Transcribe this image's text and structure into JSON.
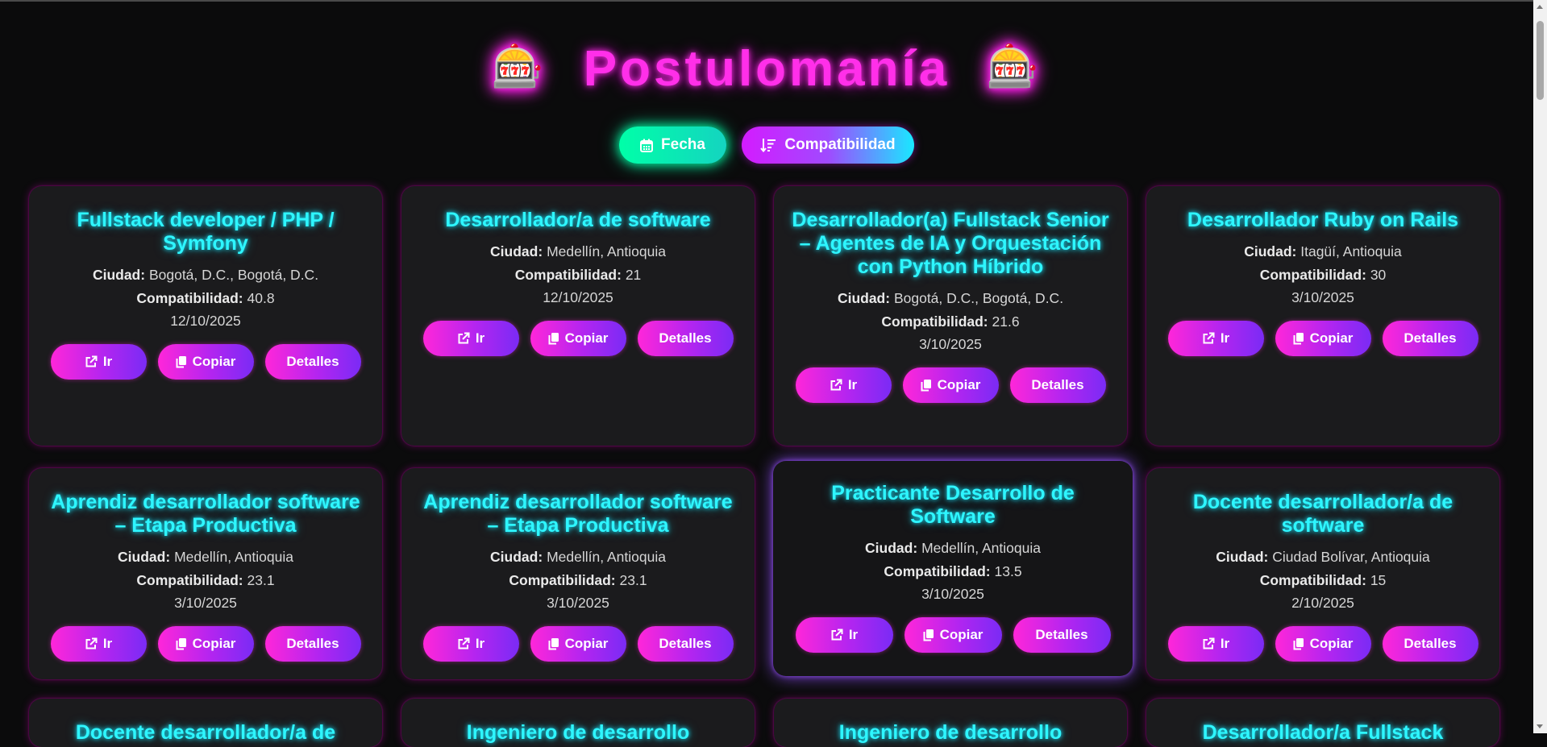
{
  "header": {
    "title": "Postulomanía",
    "emoji_left": "🎰",
    "emoji_right": "🎰"
  },
  "sort": {
    "fecha_label": "Fecha",
    "compat_label": "Compatibilidad"
  },
  "labels": {
    "ciudad": "Ciudad:",
    "compat": "Compatibilidad:",
    "ir": "Ir",
    "copiar": "Copiar",
    "detalles": "Detalles"
  },
  "jobs": [
    {
      "title": "Fullstack developer / PHP / Symfony",
      "city": "Bogotá, D.C., Bogotá, D.C.",
      "compat": "40.8",
      "date": "12/10/2025"
    },
    {
      "title": "Desarrollador/a de software",
      "city": "Medellín, Antioquia",
      "compat": "21",
      "date": "12/10/2025"
    },
    {
      "title": "Desarrollador(a) Fullstack Senior – Agentes de IA y Orquestación con Python Híbrido",
      "city": "Bogotá, D.C., Bogotá, D.C.",
      "compat": "21.6",
      "date": "3/10/2025"
    },
    {
      "title": "Desarrollador Ruby on Rails",
      "city": "Itagüí, Antioquia",
      "compat": "30",
      "date": "3/10/2025"
    },
    {
      "title": "Aprendiz desarrollador software – Etapa Productiva",
      "city": "Medellín, Antioquia",
      "compat": "23.1",
      "date": "3/10/2025"
    },
    {
      "title": "Aprendiz desarrollador software – Etapa Productiva",
      "city": "Medellín, Antioquia",
      "compat": "23.1",
      "date": "3/10/2025"
    },
    {
      "title": "Practicante Desarrollo de Software",
      "city": "Medellín, Antioquia",
      "compat": "13.5",
      "date": "3/10/2025"
    },
    {
      "title": "Docente desarrollador/a de software",
      "city": "Ciudad Bolívar, Antioquia",
      "compat": "15",
      "date": "2/10/2025"
    },
    {
      "title": "Docente desarrollador/a de"
    },
    {
      "title": "Ingeniero de desarrollo"
    },
    {
      "title": "Ingeniero de desarrollo"
    },
    {
      "title": "Desarrollador/a Fullstack"
    }
  ],
  "colors": {
    "background": "#0b0b0c",
    "card": "#1b1b1d",
    "title_pink": "#ff2fe9",
    "job_title_cyan": "#2ef6ff",
    "fecha_green": "#00ffa8"
  },
  "icons": {
    "fecha": "calendar-icon",
    "compat": "sort-descending-icon",
    "ir": "external-link-icon",
    "copiar": "copy-icon"
  }
}
